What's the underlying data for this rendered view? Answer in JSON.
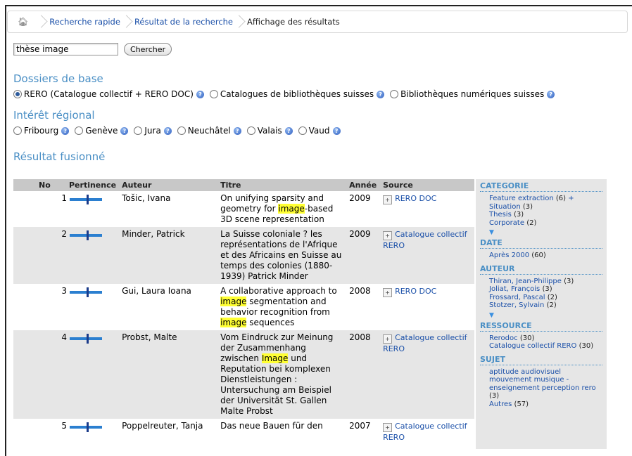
{
  "breadcrumb": {
    "home_icon": "home-icon",
    "items": [
      "Recherche rapide",
      "Résultat de la recherche"
    ],
    "current": "Affichage des résultats"
  },
  "search": {
    "value": "thèse image",
    "button_label": "Chercher"
  },
  "dossiers": {
    "title": "Dossiers de base",
    "options": [
      {
        "label": "RERO (Catalogue collectif + RERO DOC)",
        "checked": true
      },
      {
        "label": "Catalogues de bibliothèques suisses",
        "checked": false
      },
      {
        "label": "Bibliothèques numériques suisses",
        "checked": false
      }
    ]
  },
  "regional": {
    "title": "Intérêt régional",
    "options": [
      "Fribourg",
      "Genève",
      "Jura",
      "Neuchâtel",
      "Valais",
      "Vaud"
    ]
  },
  "results": {
    "title": "Résultat fusionné",
    "headers": {
      "no": "No",
      "relevance": "Pertinence",
      "author": "Auteur",
      "title": "Titre",
      "year": "Année",
      "source": "Source"
    },
    "rows": [
      {
        "no": "1",
        "author": "Tošic, Ivana",
        "title_parts": [
          "On unifying sparsity and geometry for ",
          "image",
          "-based 3D scene representation"
        ],
        "year": "2009",
        "source": "RERO DOC"
      },
      {
        "no": "2",
        "author": "Minder, Patrick",
        "title_parts": [
          "La Suisse coloniale ? les représentations de l'Afrique et des Africains en Suisse au temps des colonies (1880-1939) Patrick Minder"
        ],
        "year": "2009",
        "source": "Catalogue collectif RERO"
      },
      {
        "no": "3",
        "author": "Gui, Laura Ioana",
        "title_parts": [
          "A collaborative approach to ",
          "image",
          " segmentation and behavior recognition from ",
          "image",
          " sequences"
        ],
        "year": "2008",
        "source": "RERO DOC"
      },
      {
        "no": "4",
        "author": "Probst, Malte",
        "title_parts": [
          "Vom Eindruck zur Meinung der Zusammenhang zwischen ",
          "Image",
          " und Reputation bei komplexen Dienstleistungen : Untersuchung am Beispiel der Universität St. Gallen Malte Probst"
        ],
        "year": "2008",
        "source": "Catalogue collectif RERO"
      },
      {
        "no": "5",
        "author": "Poppelreuter, Tanja",
        "title_parts": [
          "Das neue Bauen für den"
        ],
        "year": "2007",
        "source": "Catalogue collectif RERO"
      }
    ]
  },
  "facets": {
    "categorie": {
      "title": "CATEGORIE",
      "items": [
        {
          "label": "Feature extraction",
          "count": "(6)",
          "extra": "+"
        },
        {
          "label": "Situation",
          "count": "(3)"
        },
        {
          "label": "Thesis",
          "count": "(3)"
        },
        {
          "label": "Corporate",
          "count": "(2)"
        }
      ]
    },
    "date": {
      "title": "DATE",
      "items": [
        {
          "label": "Après 2000",
          "count": "(60)"
        }
      ]
    },
    "auteur": {
      "title": "AUTEUR",
      "items": [
        {
          "label": "Thiran, Jean-Philippe",
          "count": "(3)"
        },
        {
          "label": "Joliat, François",
          "count": "(3)"
        },
        {
          "label": "Frossard, Pascal",
          "count": "(2)"
        },
        {
          "label": "Stotzer, Sylvain",
          "count": "(2)"
        }
      ]
    },
    "ressource": {
      "title": "RESSOURCE",
      "items": [
        {
          "label": "Rerodoc",
          "count": "(30)"
        },
        {
          "label": "Catalogue collectif RERO",
          "count": "(30)"
        }
      ]
    },
    "sujet": {
      "title": "SUJET",
      "items": [
        {
          "label": "aptitude audiovisuel mouvement musique - enseignement perception rero",
          "count": "(3)"
        },
        {
          "label": "Autres",
          "count": "(57)"
        }
      ]
    }
  },
  "colors": {
    "accent": "#4a8fc5",
    "link": "#1a4fa8",
    "highlight": "#ffff33"
  }
}
